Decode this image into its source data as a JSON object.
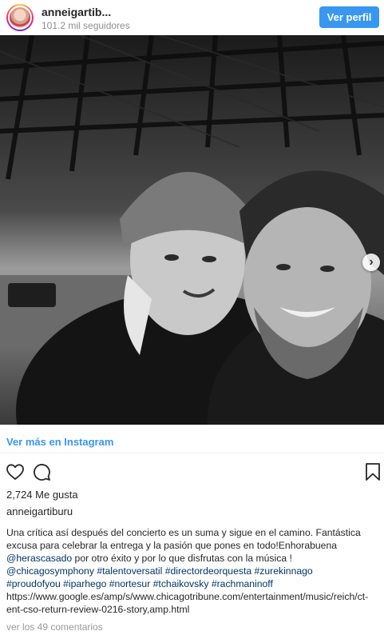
{
  "header": {
    "username": "anneigartib...",
    "followers": "101.2 mil seguidores",
    "view_profile_label": "Ver perfil"
  },
  "post": {
    "view_more_label": "Ver más en Instagram",
    "likes": "2,724 Me gusta",
    "username": "anneigartiburu",
    "caption": {
      "line1": "Una crítica así después del concierto es un suma y sigue en el camino. Fantástica",
      "line2": "excusa para celebrar la entrega y la pasión que pones en todo!Enhorabuena",
      "mention1": "@herascasado",
      "line3_rest": " por otro éxito y por lo que disfrutas con la música !",
      "line4_tags": [
        "@chicagosymphony",
        "#talentoversatil",
        "#directordeorquesta",
        "#zurekinnago"
      ],
      "line5_tags": [
        "#proudofyou",
        "#iparhego",
        "#nortesur",
        "#tchaikovsky",
        "#rachmaninoff"
      ],
      "line6": "https://www.google.es/amp/s/www.chicagotribune.com/entertainment/music/reich/ct-",
      "line7": "ent-cso-return-review-0216-story,amp.html"
    },
    "comments_link": "ver los 49 comentarios"
  },
  "icons": {
    "like": "heart-outline-icon",
    "comment": "speech-bubble-icon",
    "save": "bookmark-icon",
    "next": "chevron-right-icon"
  },
  "colors": {
    "accent": "#3897f0",
    "link": "#003569",
    "muted": "#8e8e8e"
  }
}
